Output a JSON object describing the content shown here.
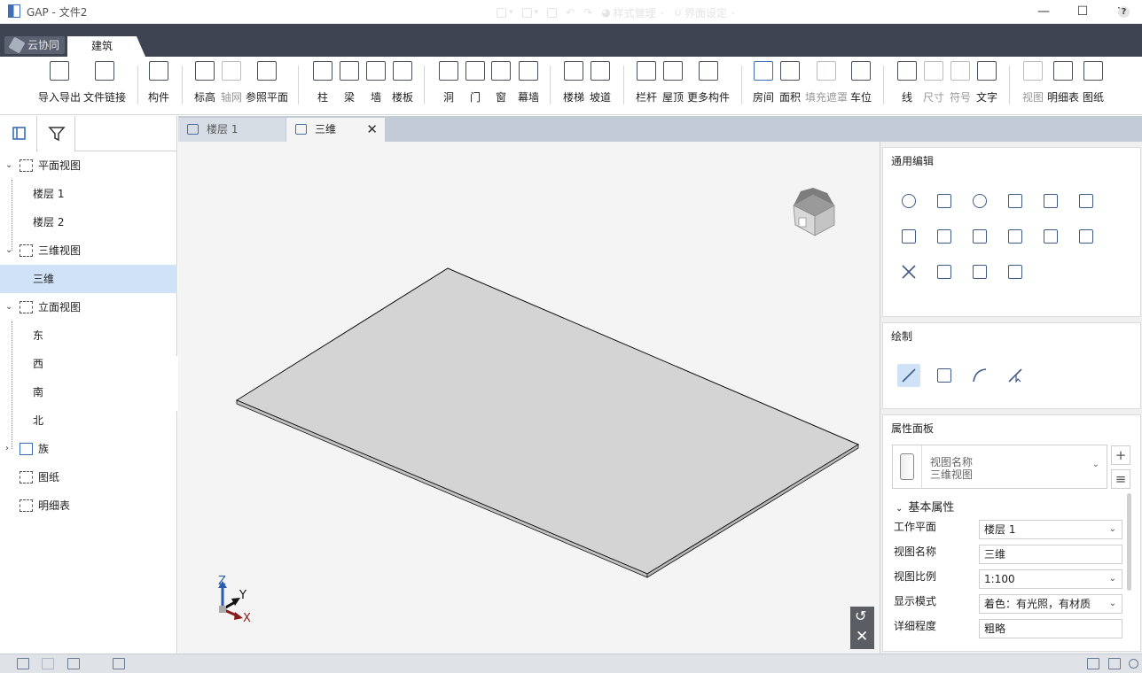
{
  "window": {
    "title": "GAP - 文件2",
    "controls": [
      "minimize-icon",
      "maximize-icon",
      "close-icon"
    ]
  },
  "ribbon": {
    "cloud_tab": "云协同",
    "active_tab": "建筑",
    "quick": {
      "style_manage": "样式管理",
      "ui_settings": "界面设定"
    },
    "help": "?"
  },
  "toolbar": {
    "import_export": "导入导出",
    "file_link": "文件链接",
    "component": "构件",
    "elevation": "标高",
    "grid": "轴网",
    "ref_plane": "参照平面",
    "column": "柱",
    "beam": "梁",
    "wall": "墙",
    "slab": "楼板",
    "opening": "洞",
    "door": "门",
    "window": "窗",
    "curtain_wall": "幕墙",
    "stair": "楼梯",
    "ramp": "坡道",
    "railing": "栏杆",
    "roof": "屋顶",
    "more_components": "更多构件",
    "room": "房间",
    "area": "面积",
    "fill_mask": "填充遮罩",
    "parking": "车位",
    "line": "线",
    "dimension": "尺寸",
    "symbol": "符号",
    "text": "文字",
    "view": "视图",
    "schedule": "明细表",
    "sheet": "图纸"
  },
  "tree": {
    "plan_views": "平面视图",
    "floor1": "楼层 1",
    "floor2": "楼层 2",
    "views_3d": "三维视图",
    "view_3d": "三维",
    "elevation_views": "立面视图",
    "east": "东",
    "west": "西",
    "south": "南",
    "north": "北",
    "families": "族",
    "sheets": "图纸",
    "schedules": "明细表"
  },
  "doc_tabs": {
    "tab1": "楼层 1",
    "tab2": "三维",
    "close": "✕"
  },
  "axis": {
    "z": "Z",
    "y": "Y",
    "x": "X"
  },
  "right_panel": {
    "general_edit": "通用编辑",
    "draw": "绘制",
    "properties": "属性面板",
    "type_line1": "视图名称",
    "type_line2": "三维视图",
    "basic_props": "基本属性",
    "rows": {
      "work_plane": {
        "label": "工作平面",
        "value": "楼层 1"
      },
      "view_name": {
        "label": "视图名称",
        "value": "三维"
      },
      "view_scale": {
        "label": "视图比例",
        "value": "1:100"
      },
      "display_mode": {
        "label": "显示模式",
        "value": "着色：有光照，有材质"
      },
      "detail_level": {
        "label": "详细程度",
        "value": "粗略"
      }
    }
  }
}
